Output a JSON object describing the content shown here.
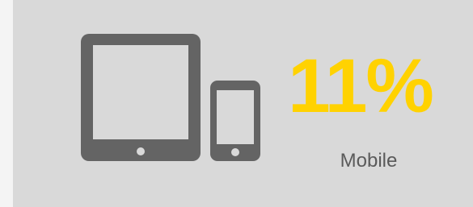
{
  "stat": {
    "value": "11%",
    "label": "Mobile"
  },
  "icons": {
    "tablet": "tablet-icon",
    "phone": "smartphone-icon"
  },
  "colors": {
    "card_background": "#d9d9d9",
    "icon": "#646464",
    "value": "#ffd200",
    "label": "#5a5a5a"
  }
}
